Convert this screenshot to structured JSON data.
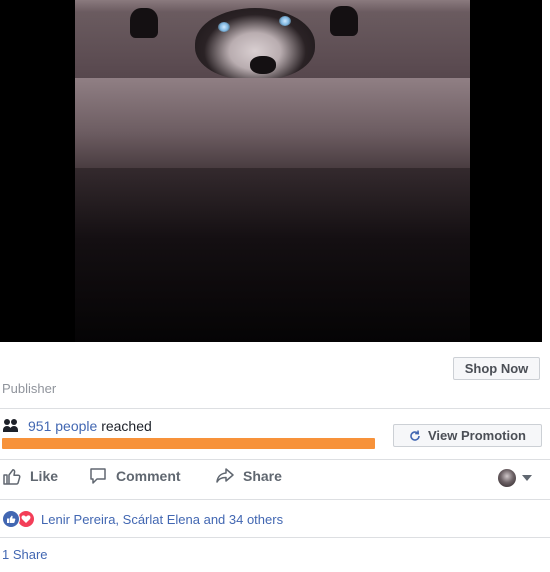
{
  "post": {
    "image": "dog-behind-fence-photo",
    "cta_button": "Shop Now",
    "publisher_label": "Publisher"
  },
  "reach": {
    "count_text": "951 people",
    "suffix": "reached",
    "progress": 1.0,
    "bar_color": "#f7923a",
    "view_promotion_label": "View Promotion"
  },
  "actions": {
    "like": "Like",
    "comment": "Comment",
    "share": "Share"
  },
  "reactions": {
    "icons": [
      "like-icon",
      "love-icon"
    ],
    "summary": "Lenir Pereira, Scárlat Elena and 34 others"
  },
  "shares": "1 Share",
  "colors": {
    "link": "#4267b2",
    "like": "#4267b2",
    "love": "#f33e58"
  }
}
